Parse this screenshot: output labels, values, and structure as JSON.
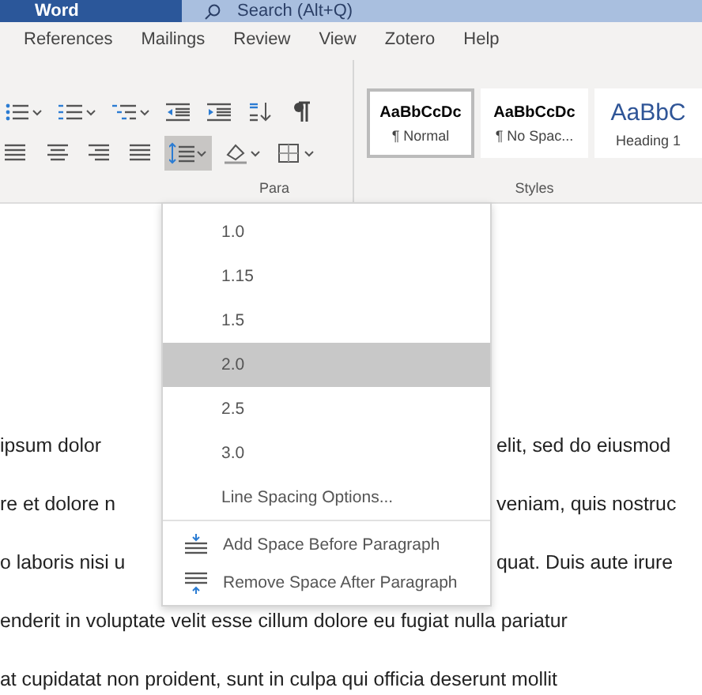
{
  "title_bar": {
    "app_name": "Word",
    "search": {
      "placeholder": "Search (Alt+Q)"
    }
  },
  "tabs": [
    {
      "label": "References",
      "selected": false
    },
    {
      "label": "Mailings",
      "selected": false
    },
    {
      "label": "Review",
      "selected": false
    },
    {
      "label": "View",
      "selected": false
    },
    {
      "label": "Zotero",
      "selected": false
    },
    {
      "label": "Help",
      "selected": false
    }
  ],
  "ribbon": {
    "paragraph_group": {
      "label": "Para",
      "rows": [
        [
          {
            "kind": "bullets",
            "selected": false
          },
          {
            "kind": "numbering",
            "selected": false
          },
          {
            "kind": "multilevel",
            "selected": false
          },
          {
            "kind": "decrease-indent",
            "selected": false
          },
          {
            "kind": "increase-indent",
            "selected": false
          },
          {
            "kind": "sort",
            "selected": false
          },
          {
            "kind": "pilcrow",
            "selected": false
          }
        ],
        [
          {
            "kind": "align-left",
            "selected": false
          },
          {
            "kind": "align-center",
            "selected": false
          },
          {
            "kind": "align-right",
            "selected": false
          },
          {
            "kind": "justify",
            "selected": false
          },
          {
            "kind": "line-spacing",
            "selected": true
          },
          {
            "kind": "shading",
            "selected": false
          },
          {
            "kind": "borders",
            "selected": false
          }
        ]
      ]
    },
    "styles_group": {
      "label": "Styles",
      "styles": [
        {
          "kind": "body",
          "preview": "AaBbCcDc",
          "name": "¶ Normal",
          "selected": true
        },
        {
          "kind": "body",
          "preview": "AaBbCcDc",
          "name": "¶ No Spac...",
          "selected": false
        },
        {
          "kind": "heading",
          "preview": "AaBbC",
          "name": "Heading 1",
          "selected": false
        }
      ]
    }
  },
  "line_spacing_menu": {
    "options": [
      {
        "label": "1.0",
        "selected": false
      },
      {
        "label": "1.15",
        "selected": false
      },
      {
        "label": "1.5",
        "selected": false
      },
      {
        "label": "2.0",
        "selected": true
      },
      {
        "label": "2.5",
        "selected": false
      },
      {
        "label": "3.0",
        "selected": false
      }
    ],
    "more": "Line Spacing Options...",
    "actions": [
      {
        "kind": "add-before",
        "label": "Add Space Before Paragraph"
      },
      {
        "kind": "remove-after",
        "label": "Remove Space After Paragraph"
      }
    ]
  },
  "document": {
    "lines": [
      {
        "left": "ipsum dolor",
        "right": "elit, sed do eiusmod"
      },
      {
        "left": "re et dolore n",
        "right": "veniam, quis nostruc"
      },
      {
        "left": "o laboris nisi u",
        "right": "quat. Duis aute irure"
      },
      {
        "left": "enderit in voluptate velit esse cillum dolore eu fugiat nulla pariatur"
      },
      {
        "left": "at cupidatat non proident, sunt in culpa qui officia deserunt mollit"
      }
    ]
  }
}
